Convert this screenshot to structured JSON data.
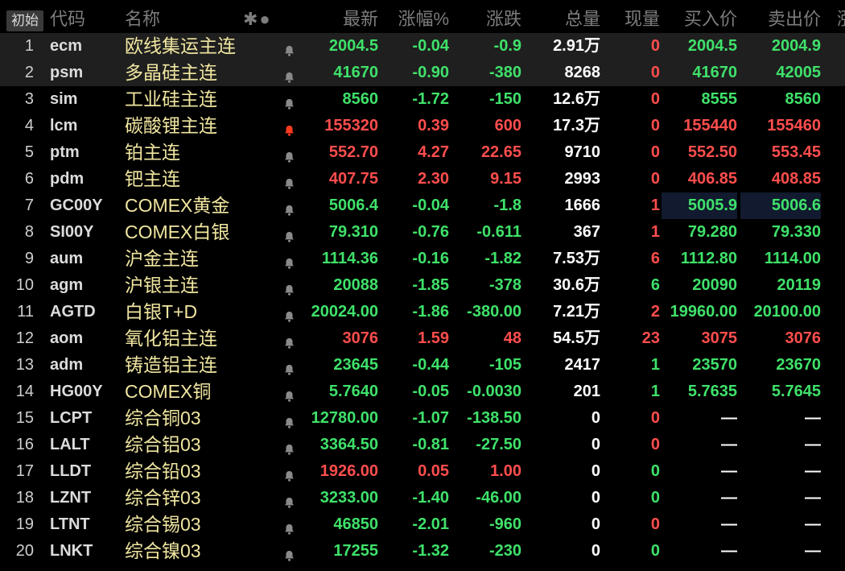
{
  "header": {
    "init_button": "初始",
    "cols": {
      "code": "代码",
      "name": "名称",
      "icons": "✱●",
      "last": "最新",
      "pct": "涨幅%",
      "chg": "涨跌",
      "vol": "总量",
      "cur": "现量",
      "bid": "买入价",
      "ask": "卖出价",
      "more": "涨"
    }
  },
  "colors": {
    "up": "#ff4d4d",
    "down": "#3fe16a",
    "alert_active": "#ff3b1f",
    "alert_idle": "#8a8a8a"
  },
  "rows": [
    {
      "idx": "1",
      "code": "ecm",
      "name": "欧线集运主连",
      "alert": false,
      "last": "2004.5",
      "pct": "-0.04",
      "chg": "-0.9",
      "vol": "2.91万",
      "cur": "0",
      "bid": "2004.5",
      "ask": "2004.9",
      "color": "g",
      "cur_color": "rd",
      "selected": true
    },
    {
      "idx": "2",
      "code": "psm",
      "name": "多晶硅主连",
      "alert": false,
      "last": "41670",
      "pct": "-0.90",
      "chg": "-380",
      "vol": "8268",
      "cur": "0",
      "bid": "41670",
      "ask": "42005",
      "color": "g",
      "cur_color": "rd",
      "selected": true
    },
    {
      "idx": "3",
      "code": "sim",
      "name": "工业硅主连",
      "alert": false,
      "last": "8560",
      "pct": "-1.72",
      "chg": "-150",
      "vol": "12.6万",
      "cur": "0",
      "bid": "8555",
      "ask": "8560",
      "color": "g",
      "cur_color": "rd"
    },
    {
      "idx": "4",
      "code": "lcm",
      "name": "碳酸锂主连",
      "alert": true,
      "last": "155320",
      "pct": "0.39",
      "chg": "600",
      "vol": "17.3万",
      "cur": "0",
      "bid": "155440",
      "ask": "155460",
      "color": "rd",
      "cur_color": "rd"
    },
    {
      "idx": "5",
      "code": "ptm",
      "name": "铂主连",
      "alert": false,
      "last": "552.70",
      "pct": "4.27",
      "chg": "22.65",
      "vol": "9710",
      "cur": "0",
      "bid": "552.50",
      "ask": "553.45",
      "color": "rd",
      "cur_color": "rd"
    },
    {
      "idx": "6",
      "code": "pdm",
      "name": "钯主连",
      "alert": false,
      "last": "407.75",
      "pct": "2.30",
      "chg": "9.15",
      "vol": "2993",
      "cur": "0",
      "bid": "406.85",
      "ask": "408.85",
      "color": "rd",
      "cur_color": "rd"
    },
    {
      "idx": "7",
      "code": "GC00Y",
      "name": "COMEX黄金",
      "alert": false,
      "last": "5006.4",
      "pct": "-0.04",
      "chg": "-1.8",
      "vol": "1666",
      "cur": "1",
      "bid": "5005.9",
      "ask": "5006.6",
      "color": "g",
      "cur_color": "rd",
      "highlight": true
    },
    {
      "idx": "8",
      "code": "SI00Y",
      "name": "COMEX白银",
      "alert": false,
      "last": "79.310",
      "pct": "-0.76",
      "chg": "-0.611",
      "vol": "367",
      "cur": "1",
      "bid": "79.280",
      "ask": "79.330",
      "color": "g",
      "cur_color": "rd"
    },
    {
      "idx": "9",
      "code": "aum",
      "name": "沪金主连",
      "alert": false,
      "last": "1114.36",
      "pct": "-0.16",
      "chg": "-1.82",
      "vol": "7.53万",
      "cur": "6",
      "bid": "1112.80",
      "ask": "1114.00",
      "color": "g",
      "cur_color": "rd"
    },
    {
      "idx": "10",
      "code": "agm",
      "name": "沪银主连",
      "alert": false,
      "last": "20088",
      "pct": "-1.85",
      "chg": "-378",
      "vol": "30.6万",
      "cur": "6",
      "bid": "20090",
      "ask": "20119",
      "color": "g",
      "cur_color": "g"
    },
    {
      "idx": "11",
      "code": "AGTD",
      "name": "白银T+D",
      "alert": false,
      "last": "20024.00",
      "pct": "-1.86",
      "chg": "-380.00",
      "vol": "7.21万",
      "cur": "2",
      "bid": "19960.00",
      "ask": "20100.00",
      "color": "g",
      "cur_color": "rd"
    },
    {
      "idx": "12",
      "code": "aom",
      "name": "氧化铝主连",
      "alert": false,
      "last": "3076",
      "pct": "1.59",
      "chg": "48",
      "vol": "54.5万",
      "cur": "23",
      "bid": "3075",
      "ask": "3076",
      "color": "rd",
      "cur_color": "rd"
    },
    {
      "idx": "13",
      "code": "adm",
      "name": "铸造铝主连",
      "alert": false,
      "last": "23645",
      "pct": "-0.44",
      "chg": "-105",
      "vol": "2417",
      "cur": "1",
      "bid": "23570",
      "ask": "23670",
      "color": "g",
      "cur_color": "g"
    },
    {
      "idx": "14",
      "code": "HG00Y",
      "name": "COMEX铜",
      "alert": false,
      "last": "5.7640",
      "pct": "-0.05",
      "chg": "-0.0030",
      "vol": "201",
      "cur": "1",
      "bid": "5.7635",
      "ask": "5.7645",
      "color": "g",
      "cur_color": "g"
    },
    {
      "idx": "15",
      "code": "LCPT",
      "name": "综合铜03",
      "alert": false,
      "last": "12780.00",
      "pct": "-1.07",
      "chg": "-138.50",
      "vol": "0",
      "cur": "0",
      "bid": "—",
      "ask": "—",
      "color": "g",
      "cur_color": "rd"
    },
    {
      "idx": "16",
      "code": "LALT",
      "name": "综合铝03",
      "alert": false,
      "last": "3364.50",
      "pct": "-0.81",
      "chg": "-27.50",
      "vol": "0",
      "cur": "0",
      "bid": "—",
      "ask": "—",
      "color": "g",
      "cur_color": "rd"
    },
    {
      "idx": "17",
      "code": "LLDT",
      "name": "综合铅03",
      "alert": false,
      "last": "1926.00",
      "pct": "0.05",
      "chg": "1.00",
      "vol": "0",
      "cur": "0",
      "bid": "—",
      "ask": "—",
      "color": "rd",
      "cur_color": "g"
    },
    {
      "idx": "18",
      "code": "LZNT",
      "name": "综合锌03",
      "alert": false,
      "last": "3233.00",
      "pct": "-1.40",
      "chg": "-46.00",
      "vol": "0",
      "cur": "0",
      "bid": "—",
      "ask": "—",
      "color": "g",
      "cur_color": "g"
    },
    {
      "idx": "19",
      "code": "LTNT",
      "name": "综合锡03",
      "alert": false,
      "last": "46850",
      "pct": "-2.01",
      "chg": "-960",
      "vol": "0",
      "cur": "0",
      "bid": "—",
      "ask": "—",
      "color": "g",
      "cur_color": "rd"
    },
    {
      "idx": "20",
      "code": "LNKT",
      "name": "综合镍03",
      "alert": false,
      "last": "17255",
      "pct": "-1.32",
      "chg": "-230",
      "vol": "0",
      "cur": "0",
      "bid": "—",
      "ask": "—",
      "color": "g",
      "cur_color": "g"
    }
  ]
}
